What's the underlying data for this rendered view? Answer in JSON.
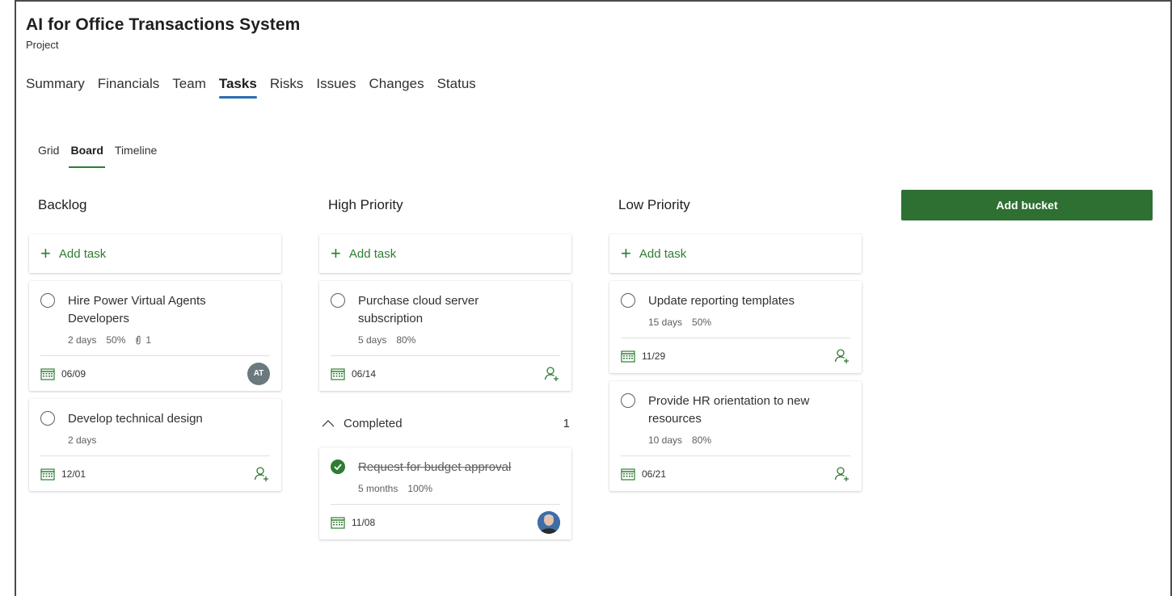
{
  "header": {
    "title": "AI for Office Transactions System",
    "subtitle": "Project"
  },
  "tabs": [
    "Summary",
    "Financials",
    "Team",
    "Tasks",
    "Risks",
    "Issues",
    "Changes",
    "Status"
  ],
  "active_tab": "Tasks",
  "subtabs": [
    "Grid",
    "Board",
    "Timeline"
  ],
  "active_subtab": "Board",
  "add_task_label": "Add task",
  "add_bucket_label": "Add bucket",
  "colors": {
    "accent_green": "#2e7d32",
    "tab_underline": "#2b6cb0",
    "avatar_gray": "#69797e"
  },
  "buckets": [
    {
      "name": "Backlog",
      "tasks": [
        {
          "name": "Hire Power Virtual Agents Developers",
          "duration": "2 days",
          "progress": "50%",
          "attachments": "1",
          "due": "06/09",
          "assignee_initials": "AT"
        },
        {
          "name": "Develop technical design",
          "duration": "2 days",
          "due": "12/01"
        }
      ]
    },
    {
      "name": "High Priority",
      "tasks": [
        {
          "name": "Purchase cloud server subscription",
          "duration": "5 days",
          "progress": "80%",
          "due": "06/14"
        }
      ],
      "completed_label": "Completed",
      "completed_count": "1",
      "completed_tasks": [
        {
          "name": "Request for budget approval",
          "duration": "5 months",
          "progress": "100%",
          "due": "11/08"
        }
      ]
    },
    {
      "name": "Low Priority",
      "tasks": [
        {
          "name": "Update reporting templates",
          "duration": "15 days",
          "progress": "50%",
          "due": "11/29"
        },
        {
          "name": "Provide HR orientation to new resources",
          "duration": "10 days",
          "progress": "80%",
          "due": "06/21"
        }
      ]
    }
  ]
}
